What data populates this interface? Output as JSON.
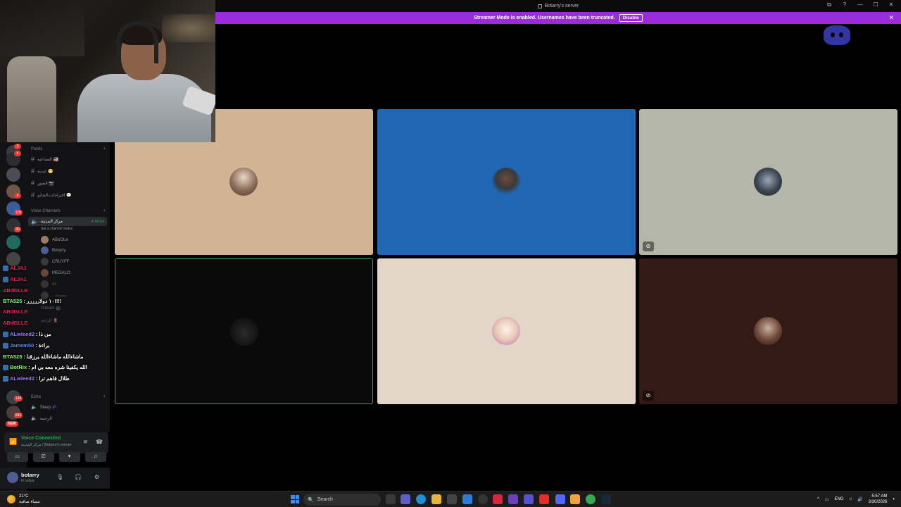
{
  "window": {
    "title": "Botarry's server",
    "controls": [
      "⧉",
      "?",
      "—",
      "☐",
      "✕"
    ]
  },
  "banner": {
    "text": "Streamer Mode is enabled. Usernames have been truncated.",
    "disable_label": "Disable",
    "close": "✕"
  },
  "servers": {
    "badges": [
      "3",
      "4",
      "4",
      "100",
      "90",
      "144",
      "641"
    ],
    "new_label": "NEW"
  },
  "channels": {
    "public_category": "Public",
    "text_channels": [
      "الصناعيه 🏭",
      "عيدية 😁",
      "الصور 📷",
      "اقتراحات-الجائم 💬"
    ],
    "voice_category": "Voice Channels",
    "active_voice": "مركز المدينه",
    "active_timer": "4:49:53",
    "channel_status": "Set a channel status",
    "members": [
      "ABoOLe",
      "Botarry",
      "CRUYFF",
      "MEGALO",
      "ell",
      "...سعيدة",
      "Stream 📺",
      "الراحه 🌷"
    ],
    "extra_category": "Extra",
    "extra_channels": [
      "Sleep 💤",
      "الزحمه"
    ]
  },
  "chat": [
    {
      "name": "ALJA1",
      "message": "",
      "color": "#e0245e"
    },
    {
      "name": "ALJA1",
      "message": "",
      "color": "#e0245e"
    },
    {
      "name": "ABdGLLE",
      "message": "",
      "color": "#e0245e"
    },
    {
      "name": "BTA525",
      "message": "١٠ دولاررررر!!!!",
      "color": "#7dff6b"
    },
    {
      "name": "ABdGLLE",
      "message": "",
      "color": "#e0245e"
    },
    {
      "name": "ABdGLLE",
      "message": "",
      "color": "#e0245e"
    },
    {
      "name": "ALwleed2",
      "message": "من ذا",
      "color": "#9e7bff"
    },
    {
      "name": "Jamem50",
      "message": "براءة",
      "color": "#5c8dff"
    },
    {
      "name": "BTA525",
      "message": "ماشاءالله ماشاءالله يرزقنا",
      "color": "#7dff6b"
    },
    {
      "name": "BotRix",
      "message": "الله يكفينا شره معه بي ام",
      "color": "#7dff6b"
    },
    {
      "name": "ALwleed2",
      "message": "طلال قاهم ترا",
      "color": "#9e7bff"
    }
  ],
  "voice_panel": {
    "status": "Voice Connected",
    "sub": "مركز المدينه / Botarry's server"
  },
  "user_panel": {
    "name": "botarry",
    "status": "In voice"
  },
  "tiles": [
    {
      "bg": "#d2b394",
      "muted": false,
      "speaking": false
    },
    {
      "bg": "#2066b3",
      "muted": false,
      "speaking": false
    },
    {
      "bg": "#b4b6a8",
      "muted": true,
      "speaking": false
    },
    {
      "bg": "#0a0a0a",
      "muted": false,
      "speaking": true
    },
    {
      "bg": "#e3d6c8",
      "muted": false,
      "speaking": false
    },
    {
      "bg": "#341a14",
      "muted": true,
      "speaking": false
    }
  ],
  "taskbar": {
    "weather_temp": "21°C",
    "weather_desc": "مساء صافية",
    "search_placeholder": "Search",
    "language": "ENG",
    "time": "5:57 AM",
    "date": "3/30/2026"
  }
}
